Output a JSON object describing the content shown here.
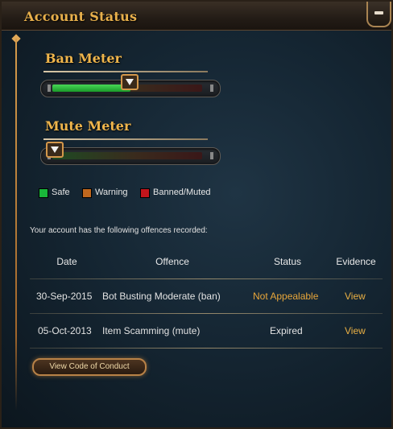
{
  "header": {
    "title": "Account Status",
    "collapse_icon": "minus-icon"
  },
  "ban_meter": {
    "label": "Ban Meter",
    "level": 0.52,
    "fill_color": "#2fbf3e"
  },
  "mute_meter": {
    "label": "Mute Meter",
    "level": 0.0,
    "fill_color": "#2fbf3e"
  },
  "legend": [
    {
      "label": "Safe",
      "color": "#19b63a"
    },
    {
      "label": "Warning",
      "color": "#c0681e"
    },
    {
      "label": "Banned/Muted",
      "color": "#c2151c"
    }
  ],
  "intro_text": "Your account has the following offences recorded:",
  "table": {
    "headers": [
      "Date",
      "Offence",
      "Status",
      "Evidence"
    ],
    "rows": [
      {
        "date": "30-Sep-2015",
        "offence": "Bot Busting Moderate (ban)",
        "status": "Not Appealable",
        "evidence": "View"
      },
      {
        "date": "05-Oct-2013",
        "offence": "Item Scamming (mute)",
        "status": "Expired",
        "evidence": "View"
      }
    ]
  },
  "code_of_conduct_button": "View Code of Conduct",
  "colors": {
    "accent": "#e8b04b",
    "status_orange": "#e8a63a",
    "link": "#eab044"
  }
}
